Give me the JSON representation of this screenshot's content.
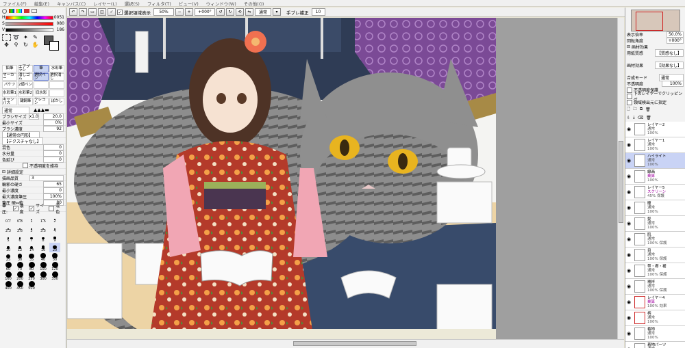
{
  "menu": [
    "ファイル(F)",
    "編集(E)",
    "キャンバス(C)",
    "レイヤー(L)",
    "選択(S)",
    "フィルタ(T)",
    "ビュー(V)",
    "ウィンドウ(W)",
    "その他(O)"
  ],
  "toolbar": {
    "selection_display": "選択領域表示",
    "zoom": "50%",
    "rotation": "+000°",
    "blend": "通常",
    "stabilizer_label": "手ブレ補正",
    "stabilizer_value": "10"
  },
  "color_sliders": [
    {
      "label": "H",
      "value": "0051",
      "color": "#ff4000"
    },
    {
      "label": "S",
      "value": "080",
      "color": "#e00000"
    },
    {
      "label": "V",
      "value": "186",
      "color": "#000000"
    }
  ],
  "tools": [
    {
      "label": "鉛筆",
      "sel": false
    },
    {
      "label": "エアブラシ",
      "sel": false
    },
    {
      "label": "筆",
      "sel": true
    },
    {
      "label": "水彩筆",
      "sel": false
    },
    {
      "label": "マーカー",
      "sel": false
    },
    {
      "label": "消しゴム",
      "sel": false
    },
    {
      "label": "選択ペン",
      "sel": true
    },
    {
      "label": "選択消し",
      "sel": false
    },
    {
      "label": "バケツ",
      "sel": false
    },
    {
      "label": "2値ペン",
      "sel": false
    },
    {
      "label": "",
      "sel": false
    },
    {
      "label": "",
      "sel": false
    },
    {
      "label": "水彩筆1",
      "sel": false
    },
    {
      "label": "水彩筆2",
      "sel": false
    },
    {
      "label": "旧水彩",
      "sel": false
    },
    {
      "label": "",
      "sel": false
    },
    {
      "label": "キャンバス",
      "sel": false
    },
    {
      "label": "薄鋼筆",
      "sel": false
    },
    {
      "label": "クレヨン",
      "sel": false
    },
    {
      "label": "ぼかし",
      "sel": false
    }
  ],
  "brush": {
    "mode": "通常",
    "size_label": "ブラシサイズ",
    "size_mult": "x1.0",
    "size_value": "20.0",
    "min_size_label": "最小サイズ",
    "min_size_value": "0%",
    "density_label": "ブラシ濃度",
    "density_value": "92",
    "shape": "【通常の円形】",
    "texture": "【テクスチャなし】",
    "mix_label": "混色",
    "mix_value": "0",
    "water_label": "水分量",
    "water_value": "0",
    "blur_label": "色延び",
    "blur_value": "0",
    "keep_opacity": "不透明度を維持",
    "detail_header": "詳細設定",
    "quality_label": "描画品質",
    "quality_value": "3",
    "hardness_label": "輪郭の硬さ",
    "hardness_value": "65",
    "min_density_label": "最小濃度",
    "min_density_value": "0",
    "max_pressure_label": "最大濃度筆圧",
    "max_pressure_value": "100%",
    "pressure_hard_label": "筆圧 硬⇔軟",
    "pressure_hard_value": "80",
    "pressure_label": "筆圧:",
    "pressure_density": "濃度",
    "pressure_size": "サイズ",
    "pressure_mix": "混色"
  },
  "brush_sizes": [
    "0.7",
    "0.8",
    "1",
    "1.5",
    "2",
    "2.3",
    "2.6",
    "3",
    "3.5",
    "4",
    "5",
    "6",
    "7",
    "8",
    "9",
    "10",
    "12",
    "14",
    "16",
    "20",
    "25",
    "30",
    "35",
    "40",
    "50",
    "60",
    "70",
    "80",
    "100",
    "120",
    "160",
    "200",
    "250",
    "300",
    "350",
    "400",
    "450",
    "500"
  ],
  "navigator": {
    "zoom_label": "表示倍率",
    "zoom_value": "50.0%",
    "angle_label": "回転角度",
    "angle_value": "+000°"
  },
  "paper": {
    "header": "画材効果",
    "paper_label": "用紙質感",
    "paper_value": "【質感なし】",
    "effect_label": "画材効果",
    "effect_value": "【効果なし】"
  },
  "layer_props": {
    "mode_label": "合成モード",
    "mode_value": "通常",
    "opacity_label": "不透明度",
    "opacity_value": "100%",
    "protect_opacity": "不透明度保護",
    "clipping": "下のレイヤーでクリッピング",
    "selection_source": "領域検出元に指定"
  },
  "layers": [
    {
      "name": "レイヤー2",
      "mode": "通常",
      "opacity": "100%",
      "sel": false,
      "red": false
    },
    {
      "name": "レイヤー1",
      "mode": "通常",
      "opacity": "100%",
      "sel": false,
      "red": false
    },
    {
      "name": "ハイライト",
      "mode": "通常",
      "opacity": "100%",
      "sel": true,
      "red": false
    },
    {
      "name": "線画",
      "mode": "乗算",
      "opacity": "100%",
      "sel": false,
      "red": false
    },
    {
      "name": "レイヤー5",
      "mode": "スクリーン",
      "opacity": "45% 保護",
      "sel": false,
      "red": false
    },
    {
      "name": "瞳",
      "mode": "通常",
      "opacity": "100%",
      "sel": false,
      "red": false
    },
    {
      "name": "髪",
      "mode": "通常",
      "opacity": "100%",
      "sel": false,
      "red": false
    },
    {
      "name": "肌",
      "mode": "通常",
      "opacity": "100% 保護",
      "sel": false,
      "red": false
    },
    {
      "name": "目",
      "mode": "通常",
      "opacity": "100% 保護",
      "sel": false,
      "red": false
    },
    {
      "name": "帯・襟・裾",
      "mode": "通常",
      "opacity": "100% 保護",
      "sel": false,
      "red": false
    },
    {
      "name": "襦袢",
      "mode": "通常",
      "opacity": "100% 保護",
      "sel": false,
      "red": false
    },
    {
      "name": "レイヤー4",
      "mode": "乗算",
      "opacity": "100% 効果",
      "sel": false,
      "red": true
    },
    {
      "name": "柄",
      "mode": "通常",
      "opacity": "100%",
      "sel": false,
      "red": true
    },
    {
      "name": "着物",
      "mode": "通常",
      "opacity": "100%",
      "sel": false,
      "red": false
    },
    {
      "name": "着物パーツ",
      "mode": "通常",
      "opacity": "100%",
      "sel": false,
      "red": false
    }
  ]
}
